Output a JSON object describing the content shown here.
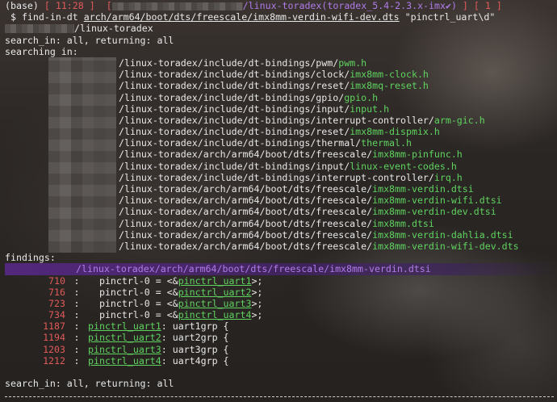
{
  "prompt": {
    "env": "(base)",
    "bracket_open": "[",
    "bracket_close": "]",
    "time": "11:28",
    "repo_path": "/linux-toradex",
    "branch": "(toradex_5.4-2.3.x-imx✔)",
    "status_count": "1",
    "dollar": "$",
    "command": "find-in-dt",
    "file_arg": "arch/arm64/boot/dts/freescale/imx8mm-verdin-wifi-dev.dts",
    "pattern_arg": "\"pinctrl_uart\\d\""
  },
  "cwd_suffix": "/linux-toradex",
  "search_in_top": "search_in: all, returning: all",
  "searching_label": "searching in:",
  "searching": [
    {
      "dir": "/linux-toradex/include/dt-bindings/pwm/",
      "file": "pwm.h"
    },
    {
      "dir": "/linux-toradex/include/dt-bindings/clock/",
      "file": "imx8mm-clock.h"
    },
    {
      "dir": "/linux-toradex/include/dt-bindings/reset/",
      "file": "imx8mq-reset.h"
    },
    {
      "dir": "/linux-toradex/include/dt-bindings/gpio/",
      "file": "gpio.h"
    },
    {
      "dir": "/linux-toradex/include/dt-bindings/input/",
      "file": "input.h"
    },
    {
      "dir": "/linux-toradex/include/dt-bindings/interrupt-controller/",
      "file": "arm-gic.h"
    },
    {
      "dir": "/linux-toradex/include/dt-bindings/reset/",
      "file": "imx8mm-dispmix.h"
    },
    {
      "dir": "/linux-toradex/include/dt-bindings/thermal/",
      "file": "thermal.h"
    },
    {
      "dir": "/linux-toradex/arch/arm64/boot/dts/freescale/",
      "file": "imx8mm-pinfunc.h"
    },
    {
      "dir": "/linux-toradex/include/dt-bindings/input/",
      "file": "linux-event-codes.h"
    },
    {
      "dir": "/linux-toradex/include/dt-bindings/interrupt-controller/",
      "file": "irq.h"
    },
    {
      "dir": "/linux-toradex/arch/arm64/boot/dts/freescale/",
      "file": "imx8mm-verdin.dtsi"
    },
    {
      "dir": "/linux-toradex/arch/arm64/boot/dts/freescale/",
      "file": "imx8mm-verdin-wifi.dtsi"
    },
    {
      "dir": "/linux-toradex/arch/arm64/boot/dts/freescale/",
      "file": "imx8mm-verdin-dev.dtsi"
    },
    {
      "dir": "/linux-toradex/arch/arm64/boot/dts/freescale/",
      "file": "imx8mm.dtsi"
    },
    {
      "dir": "/linux-toradex/arch/arm64/boot/dts/freescale/",
      "file": "imx8mm-verdin-dahlia.dtsi"
    },
    {
      "dir": "/linux-toradex/arch/arm64/boot/dts/freescale/",
      "file": "imx8mm-verdin-wifi-dev.dts"
    }
  ],
  "findings_label": "findings:",
  "findings_file": "/linux-toradex/arch/arm64/boot/dts/freescale/imx8mm-verdin.dtsi",
  "findings": [
    {
      "line": "710",
      "sep": ":",
      "pre": "  pinctrl-0 = <&",
      "match": "pinctrl_uart1",
      "post": ">;"
    },
    {
      "line": "716",
      "sep": ":",
      "pre": "  pinctrl-0 = <&",
      "match": "pinctrl_uart2",
      "post": ">;"
    },
    {
      "line": "723",
      "sep": ":",
      "pre": "  pinctrl-0 = <&",
      "match": "pinctrl_uart3",
      "post": ">;"
    },
    {
      "line": "734",
      "sep": ":",
      "pre": "  pinctrl-0 = <&",
      "match": "pinctrl_uart4",
      "post": ">;"
    },
    {
      "line": "1187",
      "sep": ":",
      "pre": "",
      "match": "pinctrl_uart1",
      "post": ": uart1grp {"
    },
    {
      "line": "1194",
      "sep": ":",
      "pre": "",
      "match": "pinctrl_uart2",
      "post": ": uart2grp {"
    },
    {
      "line": "1203",
      "sep": ":",
      "pre": "",
      "match": "pinctrl_uart3",
      "post": ": uart3grp {"
    },
    {
      "line": "1212",
      "sep": ":",
      "pre": "",
      "match": "pinctrl_uart4",
      "post": ": uart4grp {"
    }
  ],
  "search_in_bottom": "search_in: all, returning: all",
  "colors": {
    "prompt_red": "#e05a5a",
    "match_green": "#5fd35f",
    "path_purple": "#b07ce8"
  }
}
